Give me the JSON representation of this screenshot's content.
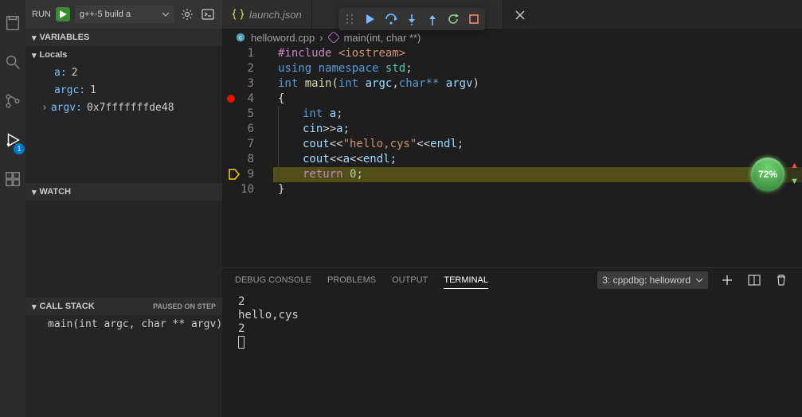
{
  "run": {
    "label": "RUN",
    "config": "g++-5 build a",
    "badge": "1"
  },
  "sidebar": {
    "variables_title": "VARIABLES",
    "locals_title": "Locals",
    "vars": [
      {
        "name": "a:",
        "value": "2",
        "expandable": false
      },
      {
        "name": "argc:",
        "value": "1",
        "expandable": false
      },
      {
        "name": "argv:",
        "value": "0x7fffffffde48",
        "expandable": true
      }
    ],
    "watch_title": "WATCH",
    "callstack_title": "CALL STACK",
    "callstack_tag": "PAUSED ON STEP",
    "stack_frame": "main(int argc, char ** argv)"
  },
  "tabs": {
    "t0": "launch.json"
  },
  "breadcrumb": {
    "file": "helloword.cpp",
    "symbol": "main(int, char **)"
  },
  "code": {
    "lines": [
      "1",
      "2",
      "3",
      "4",
      "5",
      "6",
      "7",
      "8",
      "9",
      "10"
    ],
    "breakpoint_line": 4,
    "current_line": 9,
    "l1_pre": "#include",
    "l1_inc": "<iostream>",
    "l2_kw": "using",
    "l2_ns": "namespace",
    "l2_std": "std",
    "l2_sc": ";",
    "l3_int": "int",
    "l3_main": "main",
    "l3_p1": "(",
    "l3_int2": "int",
    "l3_argc": "argc",
    "l3_c": ",",
    "l3_char": "char**",
    "l3_argv": "argv",
    "l3_p2": ")",
    "l4": "{",
    "l5_int": "int",
    "l5_a": "a",
    "l5_sc": ";",
    "l6_cin": "cin",
    "l6_op": ">>",
    "l6_a": "a",
    "l6_sc": ";",
    "l7_cout": "cout",
    "l7_op1": "<<",
    "l7_str": "\"hello,cys\"",
    "l7_op2": "<<",
    "l7_endl": "endl",
    "l7_sc": ";",
    "l8_cout": "cout",
    "l8_op1": "<<",
    "l8_a": "a",
    "l8_op2": "<<",
    "l8_endl": "endl",
    "l8_sc": ";",
    "l9_ret": "return",
    "l9_zero": "0",
    "l9_sc": ";",
    "l10": "}"
  },
  "percent": "72%",
  "panel": {
    "tabs": {
      "debug": "DEBUG CONSOLE",
      "problems": "PROBLEMS",
      "output": "OUTPUT",
      "terminal": "TERMINAL"
    },
    "term_select": "3: cppdbg: helloword",
    "terminal_output": "2\nhello,cys\n2"
  }
}
